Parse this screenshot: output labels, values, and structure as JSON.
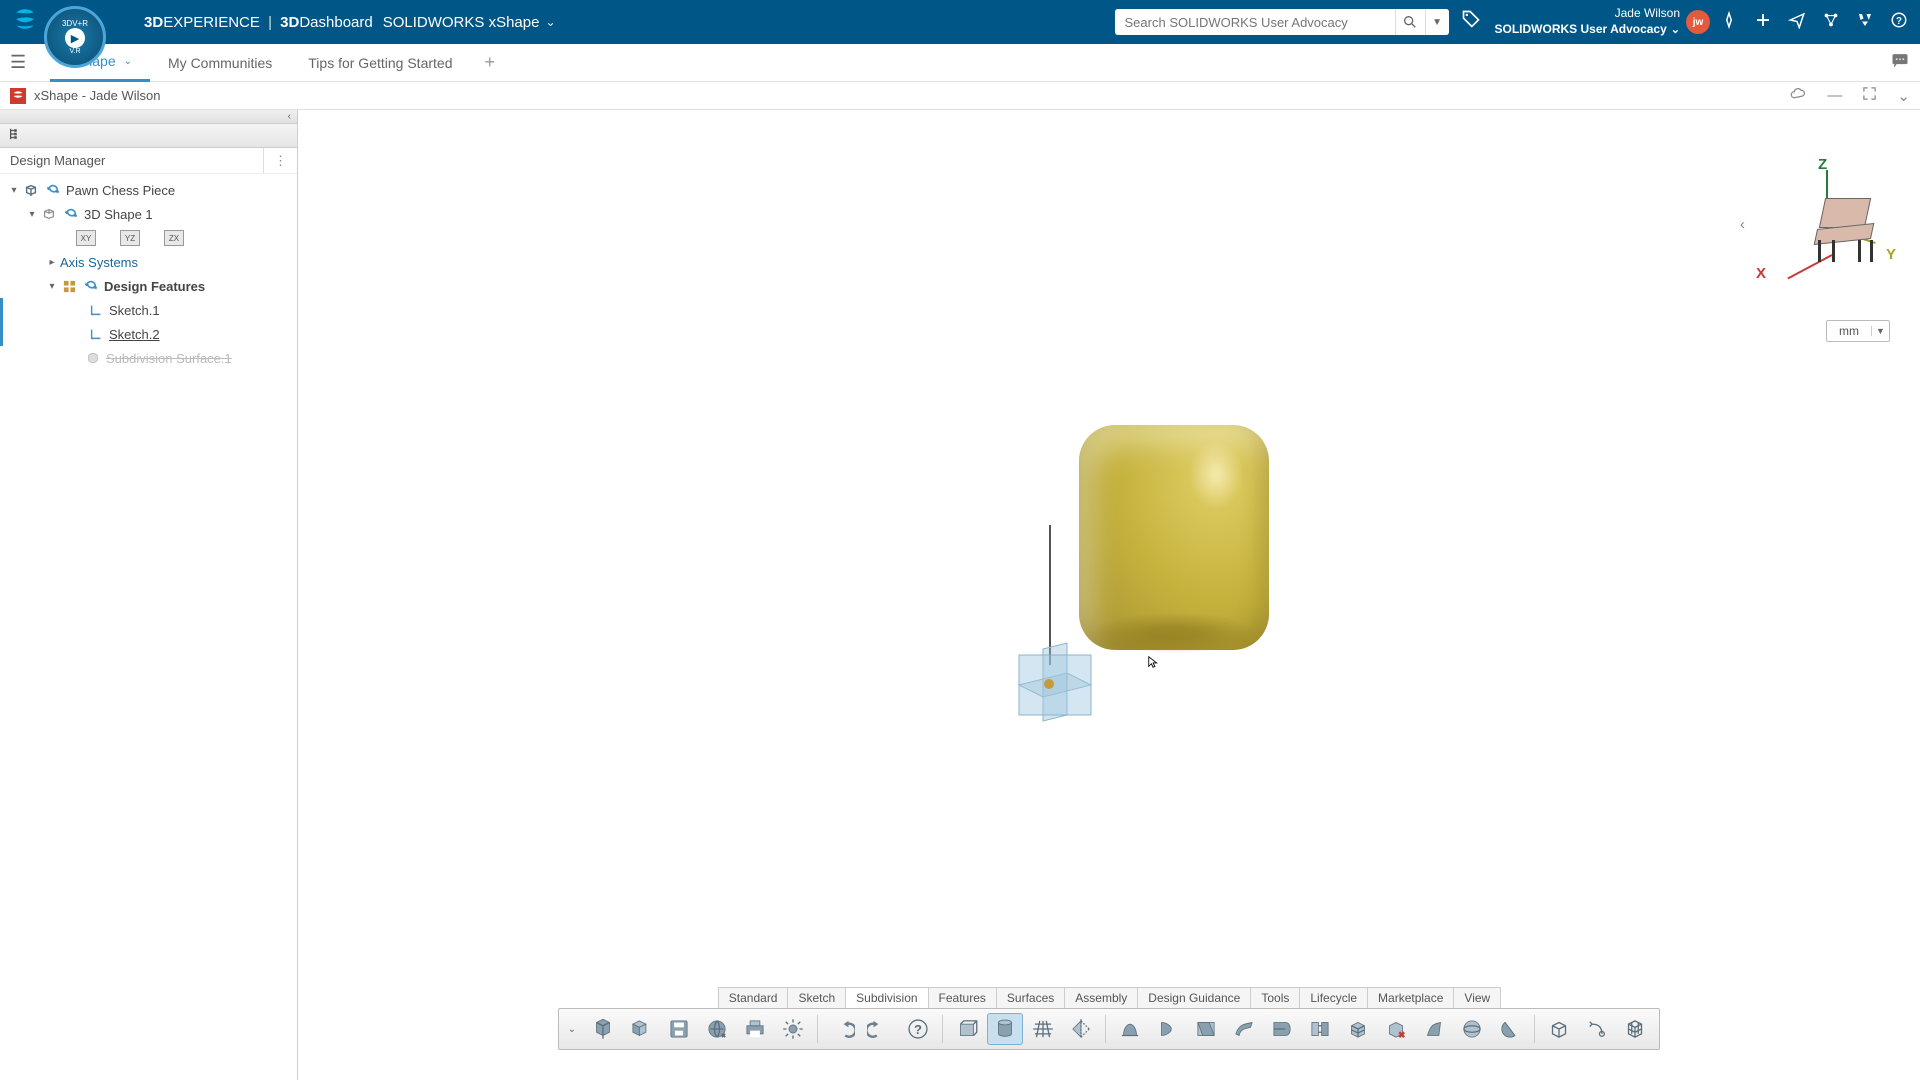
{
  "header": {
    "brand_bold1": "3D",
    "brand_text1": "EXPERIENCE",
    "brand_bold2": "3D",
    "brand_text2": "Dashboard",
    "app_name": "SOLIDWORKS xShape",
    "search_placeholder": "Search SOLIDWORKS User Advocacy",
    "user_name": "Jade Wilson",
    "user_org": "SOLIDWORKS User Advocacy",
    "avatar_initials": "jw"
  },
  "nav": {
    "tabs": [
      {
        "label": "xShape",
        "active": true
      },
      {
        "label": "My Communities",
        "active": false
      },
      {
        "label": "Tips for Getting Started",
        "active": false
      }
    ]
  },
  "doc": {
    "title": "xShape - Jade Wilson"
  },
  "panel": {
    "header": "Design Manager",
    "root": "Pawn Chess Piece",
    "shape": "3D Shape 1",
    "axis_systems": "Axis Systems",
    "design_features": "Design Features",
    "sketch1": "Sketch.1",
    "sketch2": "Sketch.2",
    "subsurface": "Subdivision Surface.1",
    "planes": {
      "xy": "XY",
      "yz": "YZ",
      "zx": "ZX"
    }
  },
  "viewport": {
    "axes": {
      "x": "X",
      "y": "Y",
      "z": "Z"
    },
    "units": "mm"
  },
  "bottom_tabs": [
    "Standard",
    "Sketch",
    "Subdivision",
    "Features",
    "Surfaces",
    "Assembly",
    "Design Guidance",
    "Tools",
    "Lifecycle",
    "Marketplace",
    "View"
  ],
  "bottom_active_tab": "Subdivision",
  "colors": {
    "header_bg": "#005686",
    "accent": "#368ec4",
    "avatar_bg": "#e55a3c"
  }
}
